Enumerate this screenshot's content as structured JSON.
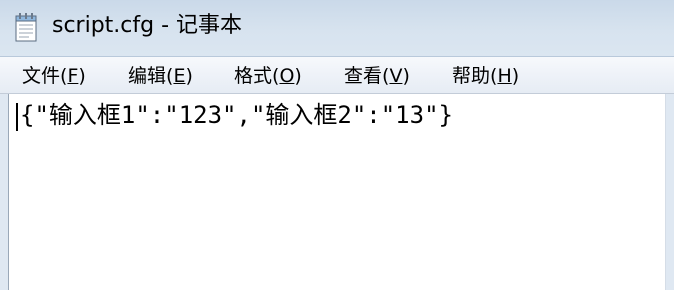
{
  "window": {
    "title": "script.cfg - 记事本",
    "icon": "notepad-icon"
  },
  "menu": [
    {
      "label": "文件",
      "mnemonic": "F"
    },
    {
      "label": "编辑",
      "mnemonic": "E"
    },
    {
      "label": "格式",
      "mnemonic": "O"
    },
    {
      "label": "查看",
      "mnemonic": "V"
    },
    {
      "label": "帮助",
      "mnemonic": "H"
    }
  ],
  "editor": {
    "content": "{\"输入框1\":\"123\",\"输入框2\":\"13\"}"
  }
}
